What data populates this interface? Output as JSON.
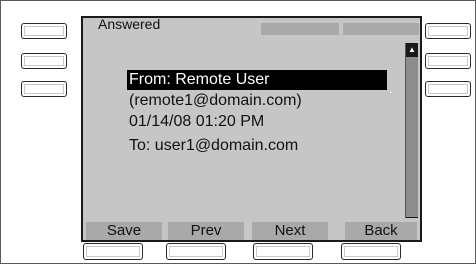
{
  "screen": {
    "title": "Answered",
    "message": {
      "from": "From: Remote User",
      "from_suffix": ".",
      "email": "(remote1@domain.com)",
      "datetime": "01/14/08 01:20 PM",
      "to": "To: user1@domain.com"
    },
    "softkeys": [
      "Save",
      "Prev",
      "Next",
      "Back"
    ],
    "scroll_up_icon": "▲",
    "scroll_down_icon": "▼"
  }
}
